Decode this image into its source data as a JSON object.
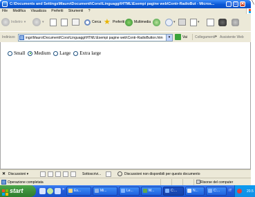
{
  "window": {
    "title": "C:\\Documents and Settings\\Mauro\\Documenti\\Corsi\\Linguaggi\\HTML\\Esempi pagine web\\Contr-RadioBut - Micros...",
    "controls": {
      "minimize": "_",
      "maximize": "□",
      "close": "✕"
    }
  },
  "menu": [
    "File",
    "Modifica",
    "Visualizza",
    "Preferiti",
    "Strumenti",
    "?"
  ],
  "toolbar": {
    "back": "Indietro",
    "search": "Cerca",
    "favorites": "Preferiti",
    "multimedia": "Multimedia"
  },
  "address": {
    "label": "Indirizzo",
    "value": "ings\\Mauro\\Documenti\\Corsi\\Linguaggi\\HTML\\Esempi pagine web\\Contr-RadioButton.htm",
    "go": "Vai",
    "links": "Collegamenti",
    "links_more": "»",
    "assistant": "Assistente Web"
  },
  "content": {
    "radios": [
      {
        "label": "Small",
        "checked": false
      },
      {
        "label": "Medium",
        "checked": true
      },
      {
        "label": "Large",
        "checked": false
      },
      {
        "label": "Extra large",
        "checked": false
      }
    ]
  },
  "discussion": {
    "close": "✕",
    "label": "Discussioni ▾",
    "subscribe": "Sottoscrivi...",
    "message": "Discussioni non disponibili per questo documento"
  },
  "status": {
    "text": "Operazione completata",
    "zone": "Risorse del computer"
  },
  "taskbar": {
    "start": "start",
    "tasks": [
      "Es...",
      "Mi...",
      "Le...",
      "M...",
      "C:...",
      "N...",
      "C:..."
    ],
    "lang": "IT",
    "clock": "20.5"
  }
}
